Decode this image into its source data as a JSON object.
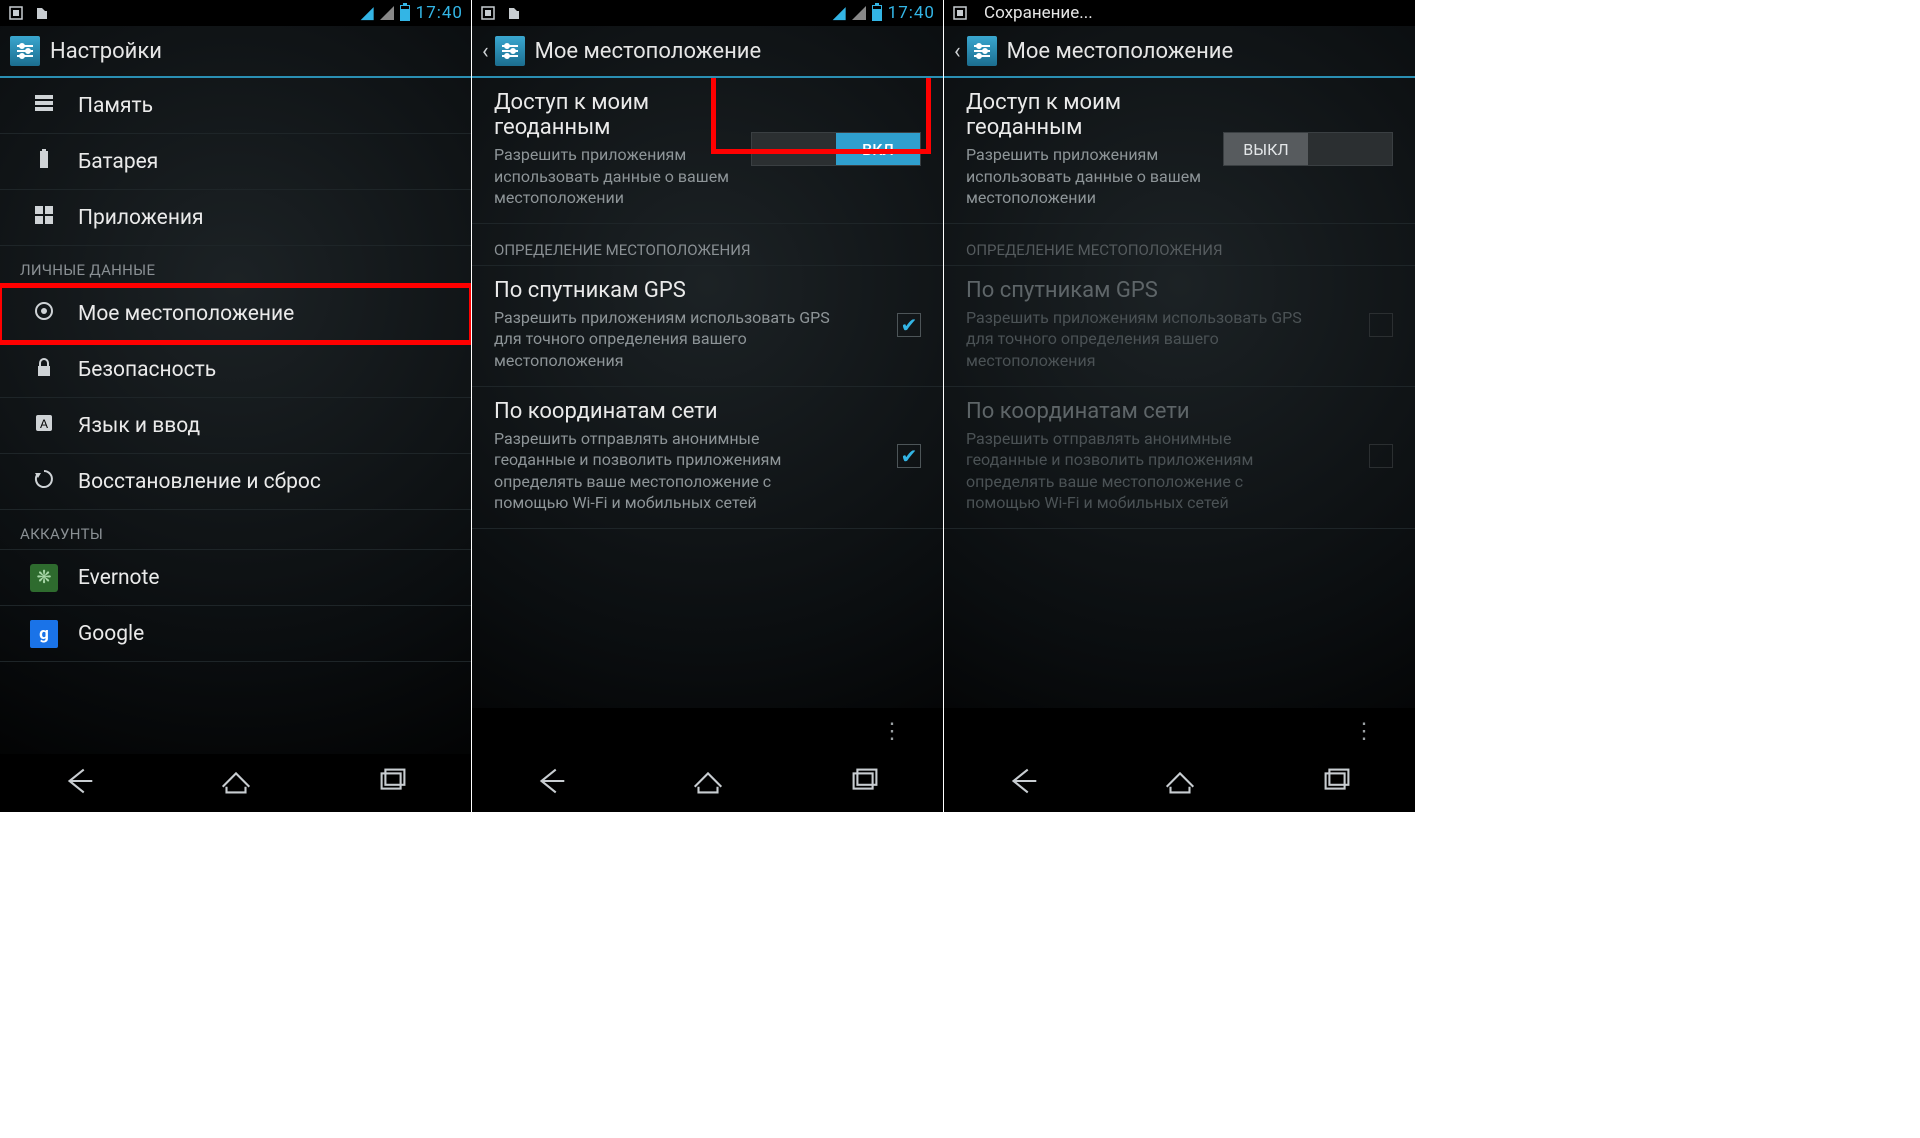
{
  "statusbar": {
    "time": "17:40",
    "saving_text": "Сохранение..."
  },
  "screen1": {
    "title": "Настройки",
    "rows": [
      {
        "label": "Память"
      },
      {
        "label": "Батарея"
      },
      {
        "label": "Приложения"
      }
    ],
    "section_personal": "ЛИЧНЫЕ ДАННЫЕ",
    "rows_personal": [
      {
        "label": "Мое местоположение"
      },
      {
        "label": "Безопасность"
      },
      {
        "label": "Язык и ввод"
      },
      {
        "label": "Восстановление и сброс"
      }
    ],
    "section_accounts": "АККАУНТЫ",
    "accounts": [
      {
        "label": "Evernote"
      },
      {
        "label": "Google"
      }
    ]
  },
  "screen2": {
    "title": "Мое местоположение",
    "access": {
      "title": "Доступ к моим геоданным",
      "desc": "Разрешить приложениям использовать данные о вашем местоположении",
      "toggle_on": "ВКЛ"
    },
    "section": "ОПРЕДЕЛЕНИЕ МЕСТОПОЛОЖЕНИЯ",
    "gps": {
      "title": "По спутникам GPS",
      "desc": "Разрешить приложениям использовать GPS для точного определения вашего местоположения"
    },
    "net": {
      "title": "По координатам сети",
      "desc": "Разрешить отправлять анонимные геоданные и позволить приложениям определять ваше местоположение с помощью Wi-Fi и мобильных сетей"
    }
  },
  "screen3": {
    "title": "Мое местоположение",
    "access": {
      "title": "Доступ к моим геоданным",
      "desc": "Разрешить приложениям использовать данные о вашем местоположении",
      "toggle_off": "ВЫКЛ"
    },
    "section": "ОПРЕДЕЛЕНИЕ МЕСТОПОЛОЖЕНИЯ",
    "gps": {
      "title": "По спутникам GPS",
      "desc": "Разрешить приложениям использовать GPS для точного определения вашего местоположения"
    },
    "net": {
      "title": "По координатам сети",
      "desc": "Разрешить отправлять анонимные геоданные и позволить приложениям определять ваше местоположение с помощью Wi-Fi и мобильных сетей"
    }
  }
}
